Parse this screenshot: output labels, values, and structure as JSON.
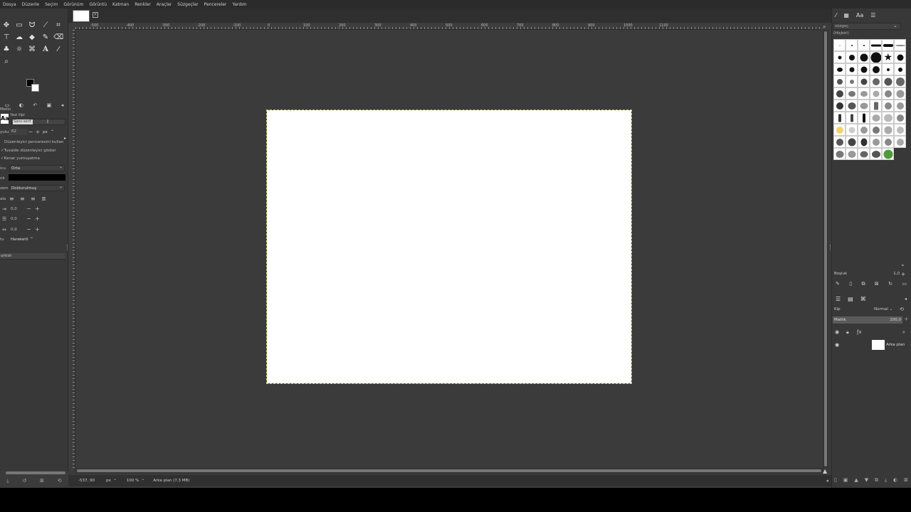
{
  "menubar": {
    "items": [
      "Dosya",
      "Düzenle",
      "Seçim",
      "Görünüm",
      "Görüntü",
      "Katman",
      "Renkler",
      "Araçlar",
      "Süzgeçler",
      "Pencereler",
      "Yardım"
    ]
  },
  "tool_options": {
    "section_title": "Metin",
    "font_label": "Yazı tipi",
    "font_value": "Sans-serif",
    "size_label": "yutu",
    "size_value": "62",
    "size_unit": "px",
    "use_editor": "Düzenleyici penceresini kullan",
    "show_on_canvas": "Tuvalde düzenleyici göster",
    "antialias": "Kenar yumuşatma",
    "hinting_label": "icu",
    "hinting_value": "Orta",
    "color_label": "nk",
    "justify_label": "zem",
    "justify_value": "Doldurulmuş",
    "align_label": "ala",
    "indent_value": "0,0",
    "line_spacing_value": "0,0",
    "letter_spacing_value": "0,0",
    "box_label": "tu",
    "box_value": "Hareketli",
    "language_value": "urkish"
  },
  "ruler": {
    "ticks": [
      "-500",
      "-400",
      "-300",
      "-200",
      "-100",
      "0",
      "100",
      "200",
      "300",
      "400",
      "500",
      "600",
      "700",
      "800",
      "900",
      "1000",
      "1100"
    ]
  },
  "statusbar": {
    "coords": "-537, 90",
    "unit": "px",
    "zoom": "100 %",
    "layer_info": "Arka plan (7,3 MB)"
  },
  "right_dock": {
    "filter_placeholder": "süzgeç",
    "none_label": "(Hiçbiri)",
    "spacing_label": "Boşluk",
    "spacing_value": "1,0",
    "mode_label": "Kip",
    "mode_value": "Normal",
    "opacity_label": "Matlık",
    "opacity_value": "100,0",
    "layer_name": "Arka plan"
  },
  "colors": {
    "app_bg": "#3b3b3b",
    "panel_bg": "#383838",
    "canvas": "#ffffff",
    "selection_outline": "#c9c070"
  }
}
